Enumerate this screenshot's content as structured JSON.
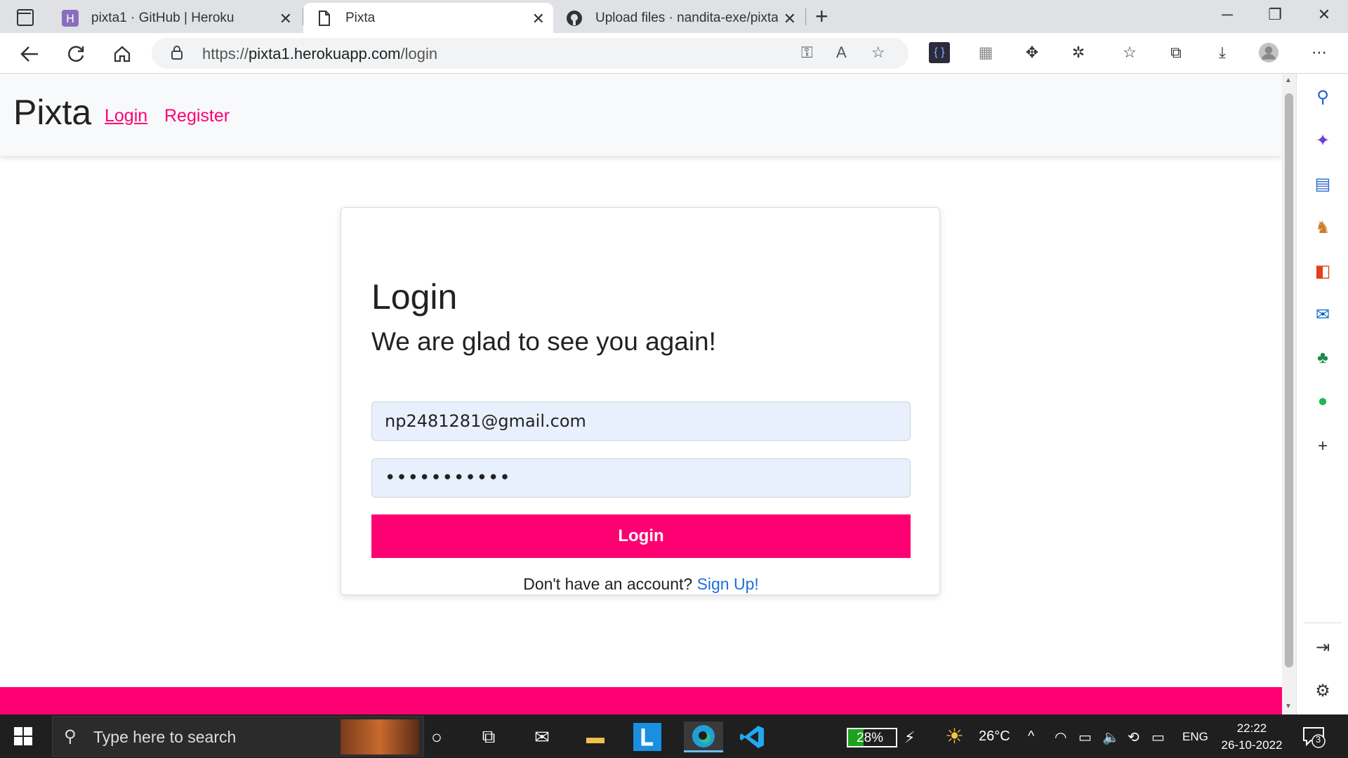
{
  "browser": {
    "tabs": [
      {
        "title": "pixta1 · GitHub | Heroku",
        "icon": "heroku-icon",
        "active": false
      },
      {
        "title": "Pixta",
        "icon": "page-icon",
        "active": true
      },
      {
        "title": "Upload files · nandita-exe/pixta-r",
        "icon": "github-icon",
        "active": false
      }
    ],
    "url_prefix": "https://",
    "url_host": "pixta1.herokuapp.com",
    "url_path": "/login"
  },
  "site": {
    "brand": "Pixta",
    "nav_login": "Login",
    "nav_register": "Register"
  },
  "login_form": {
    "title": "Login",
    "subtitle": "We are glad to see you again!",
    "email_value": "np2481281@gmail.com",
    "password_value": "•••••••••••",
    "submit_label": "Login",
    "signup_prompt": "Don't have an account?",
    "signup_link": "Sign Up!"
  },
  "colors": {
    "accent": "#ff0073",
    "link": "#1e6fd9",
    "input_bg": "#e8f0fe"
  },
  "taskbar": {
    "search_placeholder": "Type here to search",
    "battery": "28%",
    "temperature": "26°C",
    "language": "ENG",
    "time": "22:22",
    "date": "26-10-2022",
    "notifications": "3"
  }
}
